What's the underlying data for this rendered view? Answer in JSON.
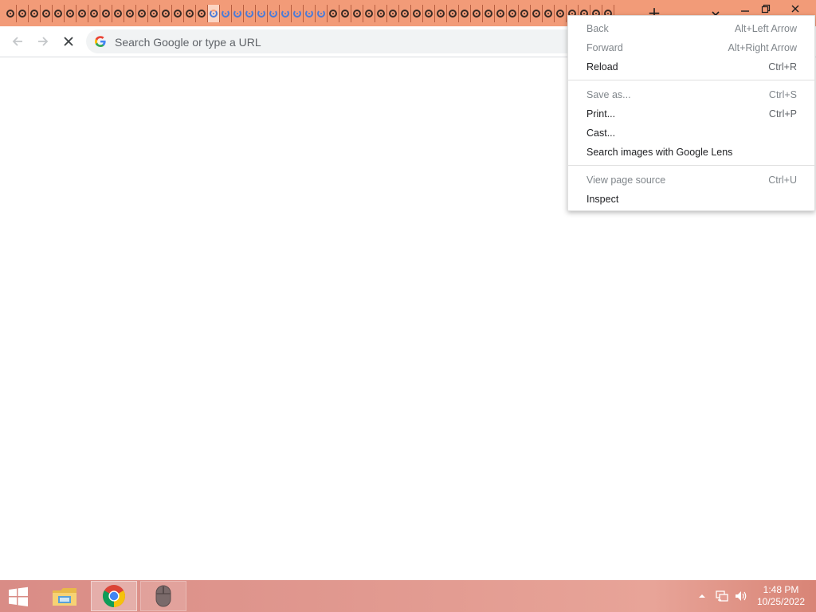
{
  "browser": {
    "tab_count": 51,
    "active_tab_index": 17,
    "loading_tab_indices": [
      17,
      18,
      19,
      20,
      21,
      22,
      23,
      24,
      25,
      26
    ],
    "window_controls": {
      "minimize_icon": "minimize-icon",
      "restore_icon": "restore-icon",
      "close_icon": "close-icon"
    },
    "new_tab_icon": "plus-icon",
    "tab_search_icon": "chevron-down-icon",
    "accent_color": "#f29b78"
  },
  "toolbar": {
    "back_icon": "arrow-left-icon",
    "forward_icon": "arrow-right-icon",
    "stop_icon": "close-icon",
    "omnibox_placeholder": "Search Google or type a URL",
    "omnibox_value": ""
  },
  "context_menu": {
    "items": [
      {
        "label": "Back",
        "shortcut": "Alt+Left Arrow",
        "disabled": true
      },
      {
        "label": "Forward",
        "shortcut": "Alt+Right Arrow",
        "disabled": true
      },
      {
        "label": "Reload",
        "shortcut": "Ctrl+R",
        "disabled": false
      },
      {
        "label": "Save as...",
        "shortcut": "Ctrl+S",
        "disabled": true
      },
      {
        "label": "Print...",
        "shortcut": "Ctrl+P",
        "disabled": false
      },
      {
        "label": "Cast...",
        "shortcut": "",
        "disabled": false
      },
      {
        "label": "Search images with Google Lens",
        "shortcut": "",
        "disabled": false
      },
      {
        "label": "View page source",
        "shortcut": "Ctrl+U",
        "disabled": true
      },
      {
        "label": "Inspect",
        "shortcut": "",
        "disabled": false
      }
    ]
  },
  "taskbar": {
    "start_icon": "windows-logo-icon",
    "apps": [
      {
        "name": "file-explorer",
        "icon": "folder-icon",
        "state": "pinned"
      },
      {
        "name": "chrome",
        "icon": "chrome-icon",
        "state": "active"
      },
      {
        "name": "mouse-app",
        "icon": "mouse-icon",
        "state": "running"
      }
    ],
    "tray": {
      "show_hidden_icon": "chevron-up-icon",
      "network_icon": "network-icon",
      "volume_icon": "speaker-icon"
    },
    "clock": {
      "time": "1:48 PM",
      "date": "10/25/2022"
    }
  }
}
